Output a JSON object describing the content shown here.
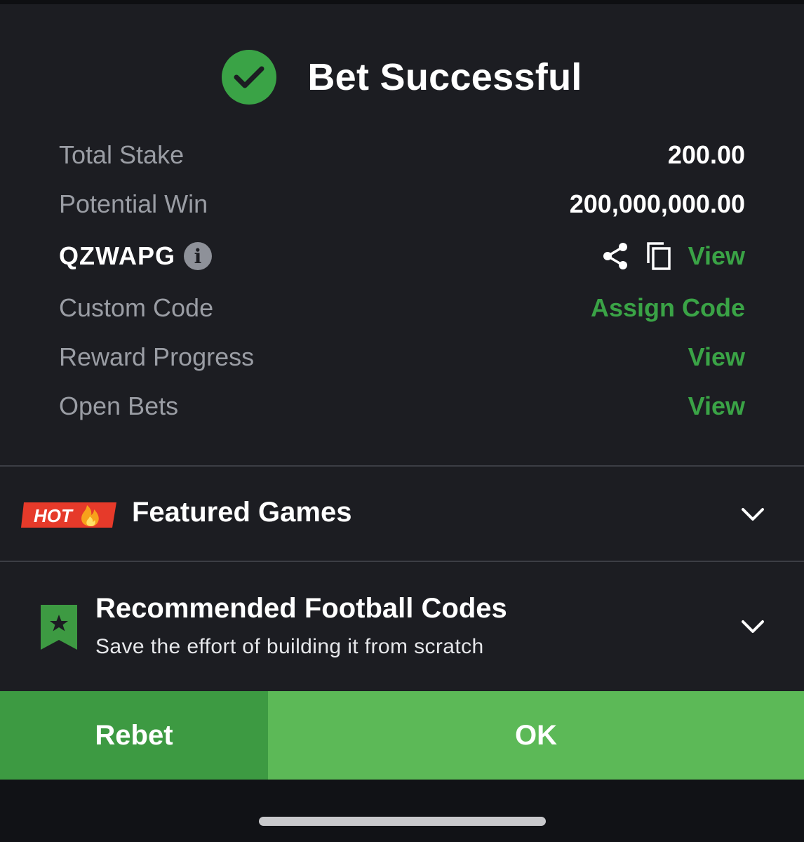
{
  "header": {
    "title": "Bet Successful",
    "status_icon": "check-circle-icon",
    "accent_color": "#3aa346"
  },
  "summary": {
    "total_stake": {
      "label": "Total Stake",
      "value": "200.00"
    },
    "potential_win": {
      "label": "Potential Win",
      "value": "200,000,000.00"
    },
    "booking_code": {
      "code": "QZWAPG",
      "info_icon": "info-icon",
      "info_glyph": "i",
      "share_icon": "share-icon",
      "copy_icon": "copy-icon",
      "view_label": "View"
    },
    "custom_code": {
      "label": "Custom Code",
      "action": "Assign Code"
    },
    "reward_progress": {
      "label": "Reward Progress",
      "action": "View"
    },
    "open_bets": {
      "label": "Open Bets",
      "action": "View"
    }
  },
  "featured": {
    "badge": "HOT",
    "badge_icon": "fire-icon",
    "title": "Featured Games",
    "toggle_icon": "chevron-down-icon"
  },
  "recommended": {
    "icon": "bookmark-star-icon",
    "title": "Recommended Football Codes",
    "subtitle": "Save the effort of building it from scratch",
    "toggle_icon": "chevron-down-icon"
  },
  "actions": {
    "rebet_label": "Rebet",
    "ok_label": "OK",
    "rebet_color": "#3d9a42",
    "ok_color": "#5cb957"
  }
}
